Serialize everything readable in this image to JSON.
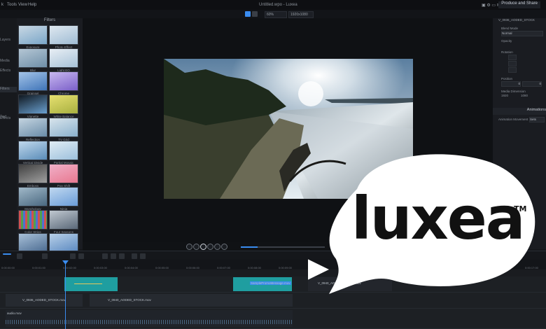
{
  "menu": {
    "items": [
      "Tools",
      "View",
      "Help"
    ]
  },
  "window": {
    "title": "Untitled.wpo - Luxea",
    "share_label": "Produce and Share"
  },
  "toolbar": {
    "zoom": "60%",
    "resolution": "1920x1080"
  },
  "left_nav": {
    "items": [
      "",
      "Layers",
      "Media",
      "",
      "",
      "Effects",
      "",
      "",
      "Filters",
      "",
      "",
      "Text",
      "",
      "Effects"
    ]
  },
  "filters": {
    "title": "Filters",
    "items": [
      "Exposure",
      "Photo Effect",
      "Blur",
      "Light EQ",
      "Grainsel",
      "Chrome",
      "Vignette",
      "White Balance",
      "Reflection",
      "TV Grid",
      "Vertical Divide",
      "Partial Mosaic",
      "Emboss",
      "Pop Shift",
      "Morphology",
      "Ninja",
      "Color Strips",
      "Four Seasons",
      "",
      ""
    ]
  },
  "inspector": {
    "clip_name": "V_0936_AODED_STOCK",
    "blend_label": "Blend Mode",
    "blend_value": "Normal",
    "opacity_label": "Opacity",
    "rotation_label": "Rotation",
    "position_label": "Position",
    "pos_x": "0",
    "pos_y": "0",
    "media_dim_label": "Media Dimension",
    "width_value": "1920",
    "height_value": "1080",
    "width_label": "Width",
    "height_label": "Height",
    "animations_label": "Animations",
    "anim_movement_label": "Animation Movement",
    "anim_movement_value": "Sets"
  },
  "timeline": {
    "ticks": [
      "0:00:00:00",
      "0:00:01:00",
      "0:00:02:00",
      "0:00:03:00",
      "0:00:04:00",
      "0:00:05:00",
      "0:00:06:00",
      "0:00:07:00",
      "0:00:08:00",
      "0:00:09:00",
      "0:00:10:00",
      "0:00:11:00",
      "0:00:12:00",
      "0:00:13:00",
      "0:00:14:00",
      "0:00:15:00",
      "0:00:16:00",
      "0:00:17:00"
    ],
    "clips": {
      "c1": "V_0936_AODED_STOCK.mov",
      "c2": "V_0940_AODED_STOCK.mov",
      "c3": "SamplePromoMessage.mov",
      "c4": "V_0940_AODED_STOCK.mov",
      "audio": "audio.mov"
    }
  },
  "playback": {
    "progress": 0.2
  },
  "logo": {
    "text": "luxea",
    "tm": "TM"
  },
  "colors": {
    "accent": "#3a8cf0",
    "clip_teal": "#1f9ea0",
    "logo_bg": "#ffffff",
    "logo_fg": "#111111"
  }
}
